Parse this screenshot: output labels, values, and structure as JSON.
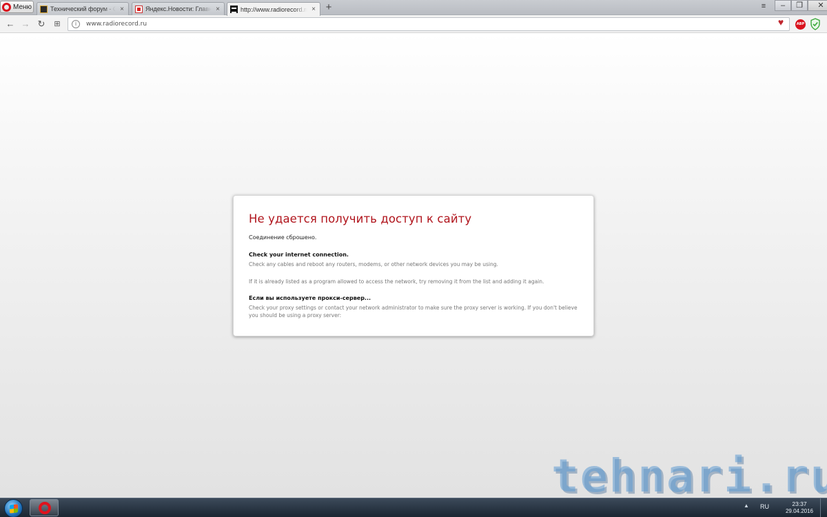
{
  "browser": {
    "menu_label": "Меню",
    "tabs": [
      {
        "title": "Технический форум - Сиб",
        "favicon": "forum-favicon",
        "active": false
      },
      {
        "title": "Яндекс.Новости: Главные",
        "favicon": "yandex-favicon",
        "active": false
      },
      {
        "title": "http://www.radiorecord.ru",
        "favicon": "radiorecord-favicon",
        "active": true
      }
    ],
    "tab_close_glyph": "×",
    "new_tab_glyph": "+",
    "address": "www.radiorecord.ru",
    "window_controls": {
      "minimize": "–",
      "maximize": "❐",
      "close": "✕"
    }
  },
  "error_page": {
    "title": "Не удается получить доступ к сайту",
    "subtitle": "Соединение сброшено.",
    "section1_heading": "Check your internet connection.",
    "section1_text": "Check any cables and reboot any routers, modems, or other network devices you may be using.",
    "section2_text": "If it is already listed as a program allowed to access the network, try removing it from the list and adding it again.",
    "section3_heading": "Если вы используете прокси-сервер...",
    "section3_text": "Check your proxy settings or contact your network administrator to make sure the proxy server is working. If you don't believe you should be using a proxy server:"
  },
  "watermark": "tehnari.ru",
  "taskbar": {
    "language": "RU",
    "time": "23:37",
    "date": "29.04.2016"
  },
  "colors": {
    "error_title": "#b0141c",
    "opera_red": "#d9121d",
    "page_background": "#f5f5f5"
  }
}
